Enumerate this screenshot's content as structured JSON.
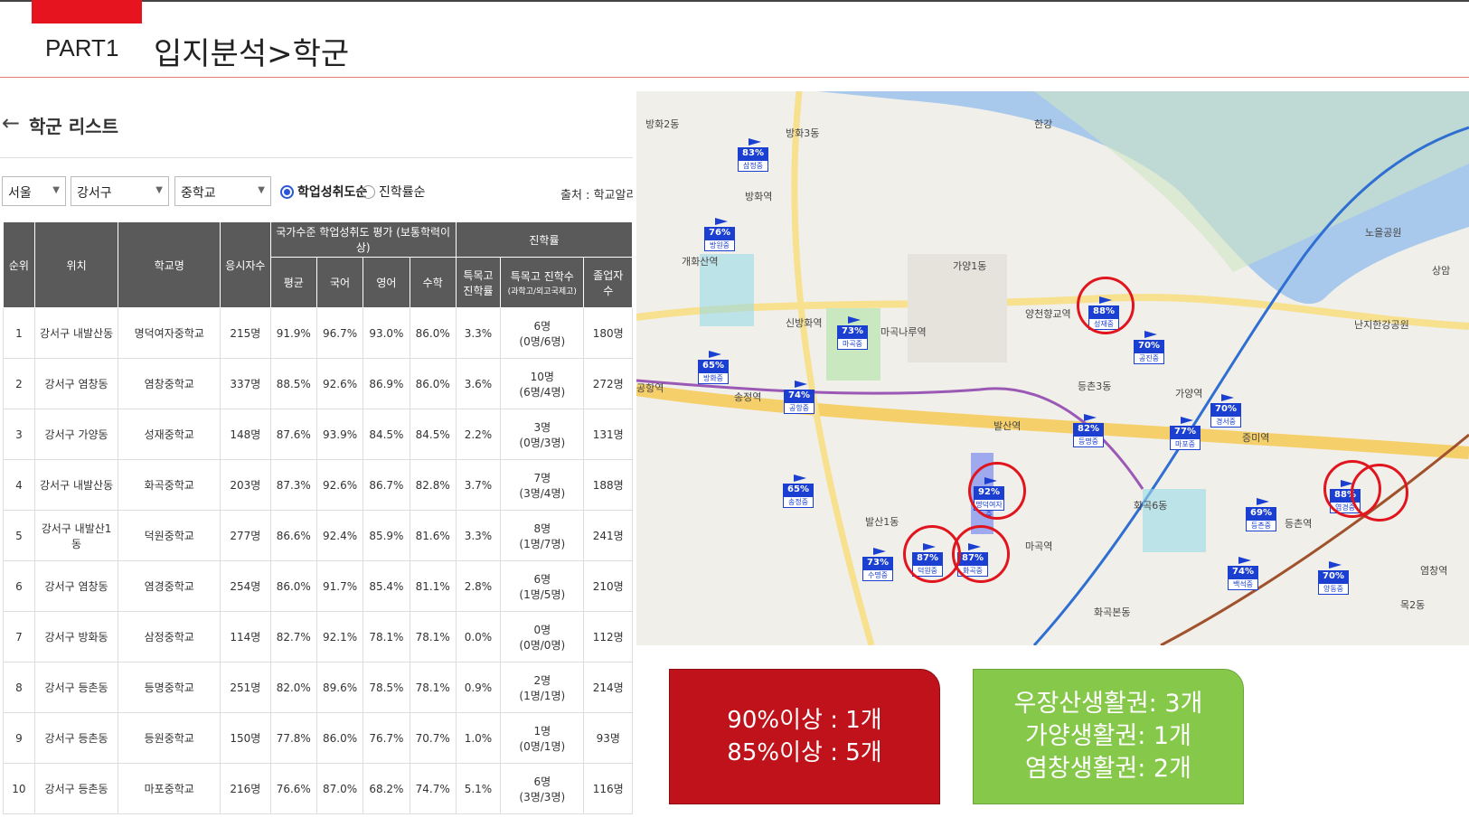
{
  "header": {
    "part": "PART1",
    "title": "입지분석>학군"
  },
  "list": {
    "title": "학군 리스트",
    "source": "출처 : 학교알리미"
  },
  "filters": {
    "city": "서울",
    "district": "강서구",
    "level": "중학교",
    "radio_achieve": "학업성취도순",
    "radio_advance": "진학률순"
  },
  "table": {
    "group_headers": {
      "achievement": "국가수준 학업성취도 평가 (보통학력이상)",
      "advance": "진학률"
    },
    "headers": {
      "rank": "순위",
      "location": "위치",
      "school": "학교명",
      "count": "응시자수",
      "avg": "평균",
      "kor": "국어",
      "eng": "영어",
      "math": "수학",
      "sp_rate_1": "특목고",
      "sp_rate_2": "진학률",
      "sp_count": "특목고 진학수",
      "sp_count_sub": "(과학고/외고국제고)",
      "grad_1": "졸업자",
      "grad_2": "수"
    },
    "rows": [
      {
        "rank": "1",
        "loc": "강서구 내발산동",
        "school": "명덕여자중학교",
        "cnt": "215명",
        "avg": "91.9%",
        "kor": "96.7%",
        "eng": "93.0%",
        "math": "86.0%",
        "rate": "3.3%",
        "sp": "6명",
        "sp2": "(0명/6명)",
        "grad": "180명"
      },
      {
        "rank": "2",
        "loc": "강서구 염창동",
        "school": "염창중학교",
        "cnt": "337명",
        "avg": "88.5%",
        "kor": "92.6%",
        "eng": "86.9%",
        "math": "86.0%",
        "rate": "3.6%",
        "sp": "10명",
        "sp2": "(6명/4명)",
        "grad": "272명"
      },
      {
        "rank": "3",
        "loc": "강서구 가양동",
        "school": "성재중학교",
        "cnt": "148명",
        "avg": "87.6%",
        "kor": "93.9%",
        "eng": "84.5%",
        "math": "84.5%",
        "rate": "2.2%",
        "sp": "3명",
        "sp2": "(0명/3명)",
        "grad": "131명"
      },
      {
        "rank": "4",
        "loc": "강서구 내발산동",
        "school": "화곡중학교",
        "cnt": "203명",
        "avg": "87.3%",
        "kor": "92.6%",
        "eng": "86.7%",
        "math": "82.8%",
        "rate": "3.7%",
        "sp": "7명",
        "sp2": "(3명/4명)",
        "grad": "188명"
      },
      {
        "rank": "5",
        "loc": "강서구 내발산1동",
        "school": "덕원중학교",
        "cnt": "277명",
        "avg": "86.6%",
        "kor": "92.4%",
        "eng": "85.9%",
        "math": "81.6%",
        "rate": "3.3%",
        "sp": "8명",
        "sp2": "(1명/7명)",
        "grad": "241명"
      },
      {
        "rank": "6",
        "loc": "강서구 염창동",
        "school": "염경중학교",
        "cnt": "254명",
        "avg": "86.0%",
        "kor": "91.7%",
        "eng": "85.4%",
        "math": "81.1%",
        "rate": "2.8%",
        "sp": "6명",
        "sp2": "(1명/5명)",
        "grad": "210명"
      },
      {
        "rank": "7",
        "loc": "강서구 방화동",
        "school": "삼정중학교",
        "cnt": "114명",
        "avg": "82.7%",
        "kor": "92.1%",
        "eng": "78.1%",
        "math": "78.1%",
        "rate": "0.0%",
        "sp": "0명",
        "sp2": "(0명/0명)",
        "grad": "112명"
      },
      {
        "rank": "8",
        "loc": "강서구 등촌동",
        "school": "등명중학교",
        "cnt": "251명",
        "avg": "82.0%",
        "kor": "89.6%",
        "eng": "78.5%",
        "math": "78.1%",
        "rate": "0.9%",
        "sp": "2명",
        "sp2": "(1명/1명)",
        "grad": "214명"
      },
      {
        "rank": "9",
        "loc": "강서구 등촌동",
        "school": "등원중학교",
        "cnt": "150명",
        "avg": "77.8%",
        "kor": "86.0%",
        "eng": "76.7%",
        "math": "70.7%",
        "rate": "1.0%",
        "sp": "1명",
        "sp2": "(0명/1명)",
        "grad": "93명"
      },
      {
        "rank": "10",
        "loc": "강서구 등촌동",
        "school": "마포중학교",
        "cnt": "216명",
        "avg": "76.6%",
        "kor": "87.0%",
        "eng": "68.2%",
        "math": "74.7%",
        "rate": "5.1%",
        "sp": "6명",
        "sp2": "(3명/3명)",
        "grad": "116명"
      }
    ]
  },
  "map": {
    "markers": [
      {
        "pct": "83%",
        "name": "삼정중"
      },
      {
        "pct": "76%",
        "name": "방원중"
      },
      {
        "pct": "65%",
        "name": "방화중"
      },
      {
        "pct": "73%",
        "name": "마곡중"
      },
      {
        "pct": "74%",
        "name": "공항중"
      },
      {
        "pct": "65%",
        "name": "송정중"
      },
      {
        "pct": "73%",
        "name": "수명중"
      },
      {
        "pct": "87%",
        "name": "덕원중"
      },
      {
        "pct": "87%",
        "name": "화곡중"
      },
      {
        "pct": "92%",
        "name": "명덕여자중"
      },
      {
        "pct": "82%",
        "name": "등명중"
      },
      {
        "pct": "88%",
        "name": "성재중"
      },
      {
        "pct": "70%",
        "name": "공진중"
      },
      {
        "pct": "77%",
        "name": "마포중"
      },
      {
        "pct": "70%",
        "name": "경서중"
      },
      {
        "pct": "69%",
        "name": "등촌중"
      },
      {
        "pct": "74%",
        "name": "백석중"
      },
      {
        "pct": "70%",
        "name": "양동중"
      },
      {
        "pct": "88%",
        "name": "염경중"
      }
    ],
    "places": [
      "방화2동",
      "방화3동",
      "개화산역",
      "방화역",
      "신방화역",
      "마곡나루역",
      "발산역",
      "송정역",
      "공항역",
      "가양1동",
      "가양역",
      "증미역",
      "등촌3동",
      "발산1동",
      "화곡본동",
      "염창역",
      "목2동",
      "한강",
      "노을공원",
      "상암",
      "난지한강공원",
      "양천향교역",
      "마곡역",
      "화곡6동",
      "등촌역"
    ]
  },
  "summary": {
    "box1_line1": "90%이상 : 1개",
    "box1_line2": "85%이상 : 5개",
    "box2_line1": "우장산생활권: 3개",
    "box2_line2": "가양생활권: 1개",
    "box2_line3": "염창생활권: 2개"
  }
}
